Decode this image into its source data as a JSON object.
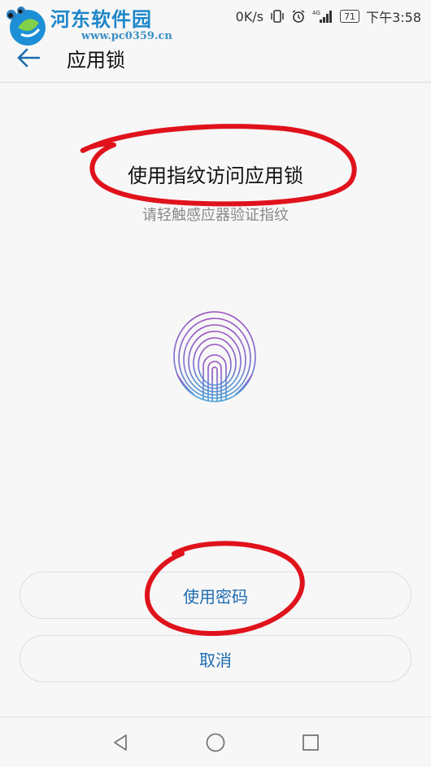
{
  "watermark": {
    "title": "河东软件园",
    "url": "www.pc0359.cn"
  },
  "status_bar": {
    "net_speed": "0K/s",
    "battery": "71",
    "time": "下午3:58",
    "network": "4G"
  },
  "app_bar": {
    "title": "应用锁"
  },
  "content": {
    "title": "使用指纹访问应用锁",
    "subtitle": "请轻触感应器验证指纹"
  },
  "buttons": {
    "use_password": "使用密码",
    "cancel": "取消"
  },
  "colors": {
    "accent": "#1c6bb0",
    "annotation": "#e0121b",
    "background": "#f7f7f7"
  }
}
